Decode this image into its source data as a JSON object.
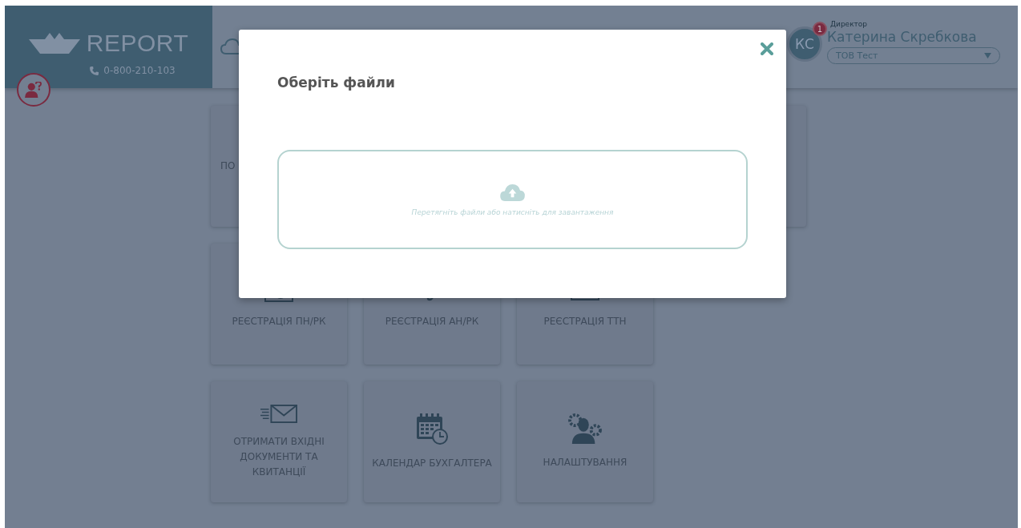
{
  "header": {
    "logo": "REPORT",
    "phone": "0-800-210-103",
    "user": {
      "initials": "КС",
      "notifications": "1",
      "role": "Директор",
      "name": "Катерина Скребкова",
      "company": "ТОВ Тест"
    }
  },
  "tile_rows": [
    [
      {
        "label": "ПО"
      },
      {}
    ],
    [
      {
        "kind": "money",
        "label": "РЕЄСТРАЦІЯ ПН/РК"
      },
      {
        "kind": "pen",
        "label": "РЕЄСТРАЦІЯ АН/РК"
      },
      {
        "kind": "box",
        "label": "РЕЄСТРАЦІЯ ТТН"
      }
    ],
    [
      {
        "kind": "mail",
        "label": "ОТРИМАТИ ВХІДНІ ДОКУМЕНТИ ТА КВИТАНЦІЇ"
      },
      {
        "kind": "calendar",
        "label": "КАЛЕНДАР БУХГАЛТЕРА"
      },
      {
        "kind": "settings",
        "label": "НАЛАШТУВАННЯ"
      }
    ]
  ],
  "modal": {
    "title": "Оберіть файли",
    "dropzone": {
      "text": "Перетягніть файли або натисніть для завантаження"
    }
  }
}
